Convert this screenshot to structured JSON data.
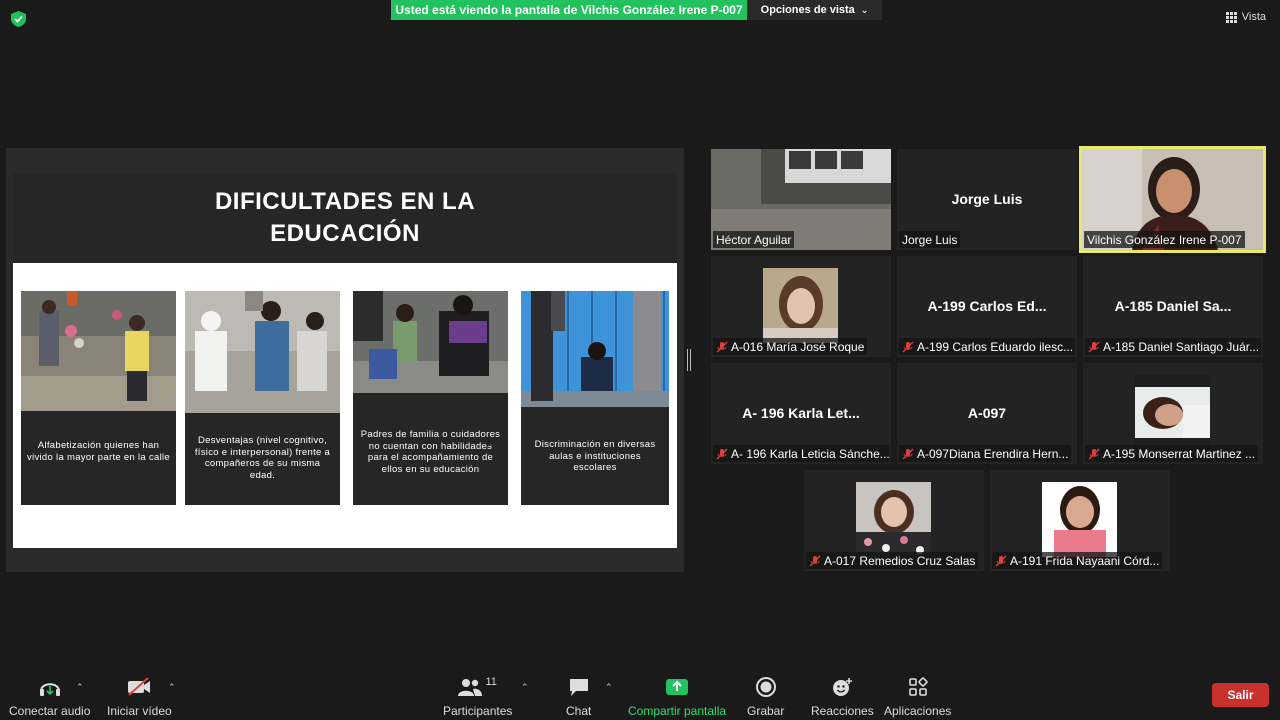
{
  "banner": {
    "text": "Usted está viendo la pantalla de Vilchis González Irene  P-007",
    "view_options": "Opciones de vista",
    "view": "Vista"
  },
  "slide": {
    "title": "DIFICULTADES EN LA EDUCACIÓN",
    "cards": [
      {
        "text": "Alfabetización quienes han vivido la mayor parte en la calle"
      },
      {
        "text": "Desventajas (nivel cognitivo, físico e interpersonal) frente a compañeros de su misma edad."
      },
      {
        "text": "Padres de familia o cuidadores no cuentan con habilidades  para el acompañamiento de ellos en su educación"
      },
      {
        "text": "Discriminación en diversas aulas e instituciones escolares"
      }
    ]
  },
  "participants": [
    {
      "label": "Héctor Aguilar",
      "big": "",
      "muted": false
    },
    {
      "label": "Jorge Luis",
      "big": "Jorge Luis",
      "muted": false
    },
    {
      "label": "Vilchis González Irene  P-007",
      "big": "",
      "muted": false,
      "active": true
    },
    {
      "label": "A-016 María José Roque",
      "big": "",
      "muted": true
    },
    {
      "label": "A-199 Carlos Eduardo ilesc...",
      "big": "A-199 Carlos Ed...",
      "muted": true
    },
    {
      "label": "A-185 Daniel Santiago Juár...",
      "big": "A-185 Daniel Sa...",
      "muted": true
    },
    {
      "label": "A- 196 Karla Leticia Sánche...",
      "big": "A- 196 Karla Let...",
      "muted": true
    },
    {
      "label": "A-097Diana Erendira Hern...",
      "big": "A-097",
      "muted": true
    },
    {
      "label": "A-195 Monserrat Martinez ...",
      "big": "",
      "muted": true
    },
    {
      "label": "A-017 Remedios Cruz Salas",
      "big": "",
      "muted": true
    },
    {
      "label": "A-191 Frida Nayaani Córd...",
      "big": "",
      "muted": true
    }
  ],
  "toolbar": {
    "audio": "Conectar audio",
    "video": "Iniciar vídeo",
    "participants": "Participantes",
    "participants_count": "11",
    "chat": "Chat",
    "share": "Compartir pantalla",
    "record": "Grabar",
    "reactions": "Reacciones",
    "apps": "Aplicaciones",
    "leave": "Salir"
  },
  "colors": {
    "share_green": "#22c35e",
    "active_speaker": "#e8e86a",
    "leave_red": "#c8312e",
    "mute_red": "#e0403c"
  }
}
